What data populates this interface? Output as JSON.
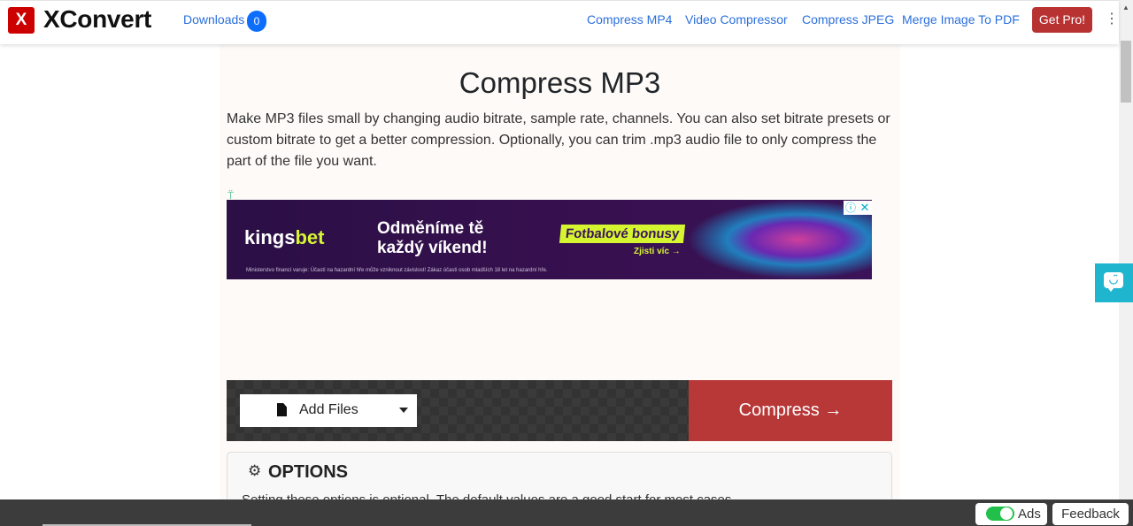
{
  "header": {
    "logo_letter": "X",
    "brand": "XConvert",
    "downloads_label": "Downloads",
    "downloads_count": "0",
    "nav_links": [
      "Compress MP4",
      "Video Compressor",
      "Compress JPEG",
      "Merge Image To PDF"
    ],
    "get_pro_label": "Get Pro!",
    "more_icon": "⋮"
  },
  "main": {
    "title": "Compress MP3",
    "description": "Make MP3 files small by changing audio bitrate, sample rate, channels. You can also set bitrate presets or custom bitrate to get a better compression. Optionally, you can trim .mp3 audio file to only compress the part of the file you want."
  },
  "ad": {
    "marker": "⍡",
    "logo_main": "kings",
    "logo_accent": "bet",
    "headline_line1": "Odměníme tě",
    "headline_line2": "každý víkend!",
    "bonus": "Fotbalové bonusy",
    "cta": "Zjisti víc →",
    "disclaimer": "Ministerstvo financí varuje: Účastí na hazardní hře může vzniknout závislost! Zákaz účasti osob mladších 18 let na hazardní hře.",
    "info_icon": "ⓘ",
    "close_icon": "✕"
  },
  "toolbar": {
    "add_files_label": "Add Files",
    "compress_label": "Compress →"
  },
  "options": {
    "gear_icon": "⚙",
    "title": "OPTIONS",
    "text": "Setting these options is optional. The default values are a good start for most cases."
  },
  "chat": {
    "face": "◡̈"
  },
  "footer": {
    "ads_label": "Ads",
    "ads_enabled": true,
    "feedback_label": "Feedback"
  },
  "colors": {
    "brand_red": "#cc0000",
    "accent_red": "#b83838",
    "link_blue": "#2a6fdb",
    "badge_blue": "#0d6efd",
    "chat_teal": "#1fb5cf",
    "toggle_green": "#22c04b"
  }
}
